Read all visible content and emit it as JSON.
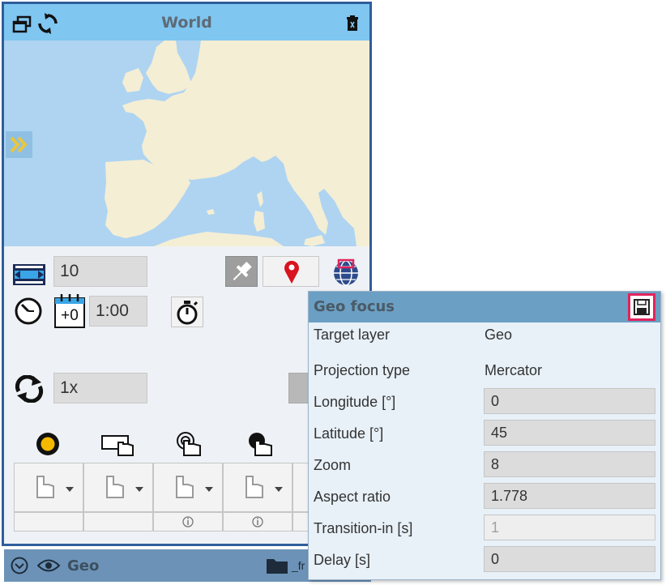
{
  "window": {
    "title": "World"
  },
  "controls": {
    "width_value": "10",
    "date_offset": "+0",
    "time_value": "1:00",
    "loop_value": "1x"
  },
  "bottom_bar": {
    "label": "Geo",
    "trailing_text": "_fr"
  },
  "geo_focus": {
    "title": "Geo focus",
    "properties": [
      {
        "label": "Target layer",
        "value": "Geo"
      },
      {
        "label": "Projection type",
        "value": "Mercator"
      },
      {
        "label": "Longitude [°]",
        "value": "0"
      },
      {
        "label": "Latitude [°]",
        "value": "45"
      },
      {
        "label": "Zoom",
        "value": "8"
      },
      {
        "label": "Aspect ratio",
        "value": "1.778"
      },
      {
        "label": "Transition-in [s]",
        "value": "1"
      },
      {
        "label": "Delay [s]",
        "value": "0"
      }
    ]
  },
  "icons": {
    "titlebar": [
      "restore-icon",
      "refresh-icon",
      "trash-icon"
    ],
    "controls": [
      "width-icon",
      "clock-icon",
      "calendar-icon",
      "stopwatch-icon",
      "pin-icon",
      "location-marker-icon",
      "globe-icon",
      "loop-icon"
    ],
    "gestures": [
      "record-icon",
      "hand-swipe-icon",
      "hand-touch-icon",
      "hand-press-icon"
    ]
  },
  "colors": {
    "titlebar": "#7fc6f1",
    "panel_border": "#2f5e9c",
    "map_water": "#aed4f1",
    "map_land": "#f4eed5",
    "popup_header": "#6b9fc3",
    "highlight": "#e0245e",
    "marker_red": "#d8141e"
  }
}
